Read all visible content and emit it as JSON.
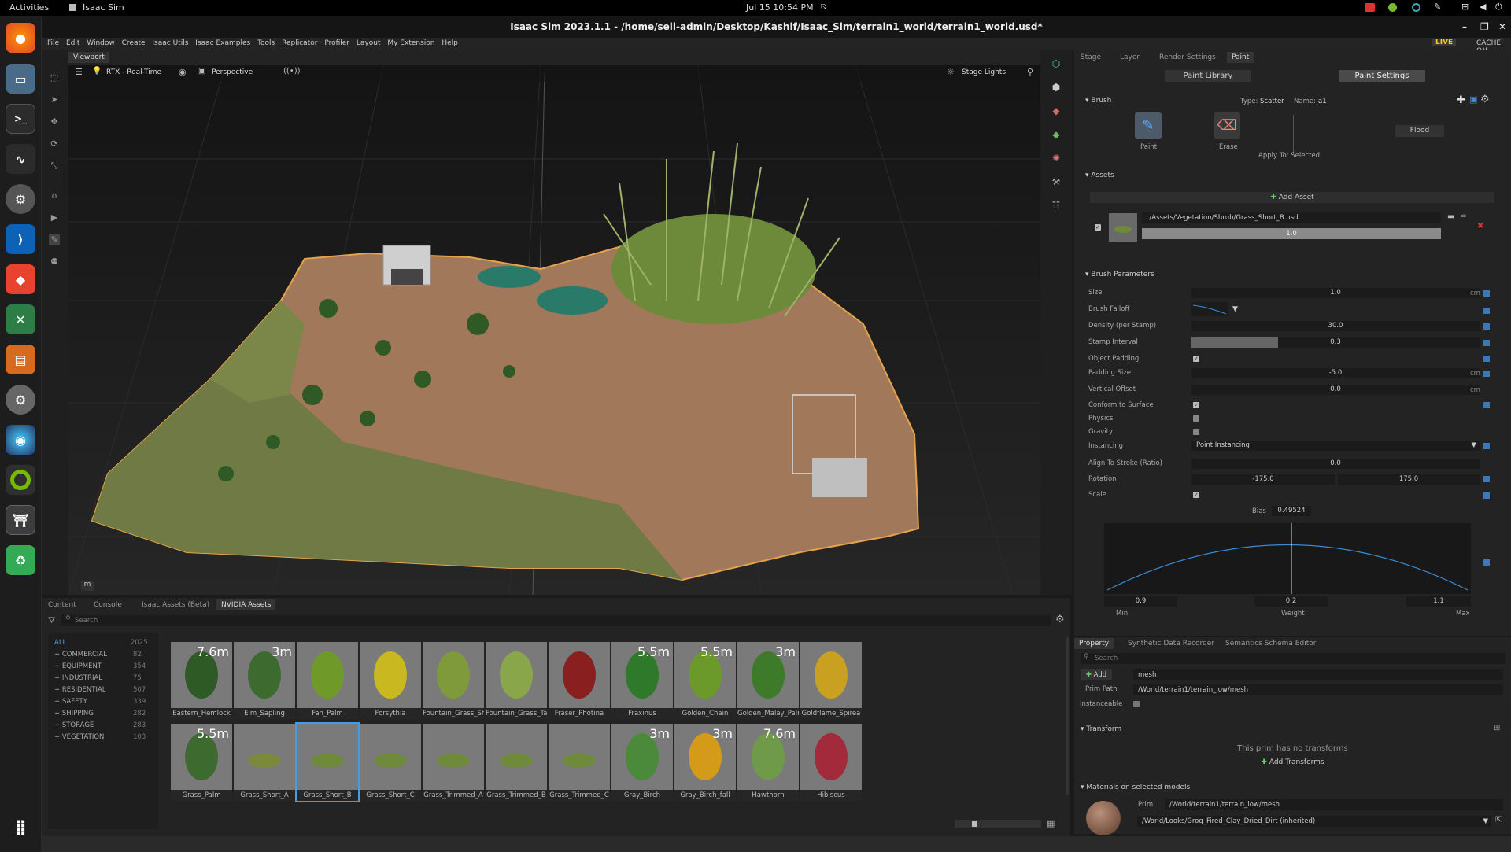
{
  "system": {
    "activities": "Activities",
    "app_name": "Isaac Sim",
    "clock": "Jul 15  10:54 PM"
  },
  "window": {
    "title": "Isaac Sim 2023.1.1 - /home/seil-admin/Desktop/Kashif/Isaac_Sim/terrain1_world/terrain1_world.usd*",
    "live": "LIVE",
    "cache": "CACHE: ON"
  },
  "menu": [
    "File",
    "Edit",
    "Window",
    "Create",
    "Isaac Utils",
    "Isaac Examples",
    "Tools",
    "Replicator",
    "Profiler",
    "Layout",
    "My Extension",
    "Help"
  ],
  "viewport": {
    "tab": "Viewport",
    "renderer": "RTX - Real-Time",
    "camera": "Perspective",
    "lights": "Stage Lights",
    "corner_label": "m"
  },
  "right_tabs": [
    "Stage",
    "Layer",
    "Render Settings",
    "Paint"
  ],
  "paint": {
    "library_btn": "Paint Library",
    "settings_btn": "Paint Settings",
    "brush_section": "Brush",
    "type_label": "Type:",
    "type_value": "Scatter",
    "name_label": "Name:",
    "name_value": "a1",
    "paint_tool": "Paint",
    "erase_tool": "Erase",
    "flood_btn": "Flood",
    "apply_to": "Apply To: Selected",
    "assets_section": "Assets",
    "add_asset": "Add Asset",
    "asset_path": "../Assets/Vegetation/Shrub/Grass_Short_B.usd",
    "asset_weight": "1.0",
    "params_section": "Brush Parameters",
    "params": [
      {
        "label": "Size",
        "value": "1.0",
        "unit": "cm"
      },
      {
        "label": "Brush Falloff",
        "value": "",
        "unit": ""
      },
      {
        "label": "Density (per Stamp)",
        "value": "30.0",
        "unit": ""
      },
      {
        "label": "Stamp Interval",
        "value": "0.3",
        "unit": ""
      },
      {
        "label": "Object Padding",
        "value": "",
        "unit": ""
      },
      {
        "label": "Padding Size",
        "value": "-5.0",
        "unit": "cm"
      },
      {
        "label": "Vertical Offset",
        "value": "0.0",
        "unit": "cm"
      },
      {
        "label": "Conform to Surface",
        "value": "",
        "unit": ""
      },
      {
        "label": "Physics",
        "value": "",
        "unit": ""
      },
      {
        "label": "Gravity",
        "value": "",
        "unit": ""
      },
      {
        "label": "Instancing",
        "value": "Point Instancing",
        "unit": ""
      },
      {
        "label": "Align To Stroke (Ratio)",
        "value": "0.0",
        "unit": ""
      },
      {
        "label": "Rotation",
        "value": "-175.0",
        "value2": "175.0",
        "unit": ""
      },
      {
        "label": "Scale",
        "value": "",
        "unit": ""
      }
    ],
    "stamp_interval_fill": 0.3,
    "bias_label": "Bias",
    "bias_value": "0.49524",
    "min_value": "0.9",
    "weight_value": "0.2",
    "max_value": "1.1",
    "min_label": "Min",
    "weight_label": "Weight",
    "max_label": "Max"
  },
  "bottom_tabs": [
    "Content",
    "Console",
    "Isaac Assets (Beta)",
    "NVIDIA Assets"
  ],
  "assets": {
    "search_placeholder": "Search",
    "categories": [
      {
        "name": "ALL",
        "count": "2025"
      },
      {
        "name": "+ COMMERCIAL",
        "count": "82"
      },
      {
        "name": "+ EQUIPMENT",
        "count": "354"
      },
      {
        "name": "+ INDUSTRIAL",
        "count": "75"
      },
      {
        "name": "+ RESIDENTIAL",
        "count": "507"
      },
      {
        "name": "+ SAFETY",
        "count": "339"
      },
      {
        "name": "+ SHIPPING",
        "count": "282"
      },
      {
        "name": "+ STORAGE",
        "count": "283"
      },
      {
        "name": "+ VEGETATION",
        "count": "103"
      }
    ],
    "items": [
      {
        "name": "Eastern_Hemlock",
        "size": "7.6m"
      },
      {
        "name": "Elm_Sapling",
        "size": "3m"
      },
      {
        "name": "Fan_Palm",
        "size": ""
      },
      {
        "name": "Forsythia",
        "size": ""
      },
      {
        "name": "Fountain_Grass_Short",
        "size": ""
      },
      {
        "name": "Fountain_Grass_Tall",
        "size": ""
      },
      {
        "name": "Fraser_Photina",
        "size": ""
      },
      {
        "name": "Fraxinus",
        "size": "5.5m"
      },
      {
        "name": "Golden_Chain",
        "size": "5.5m"
      },
      {
        "name": "Golden_Malay_Palm",
        "size": "3m"
      },
      {
        "name": "Goldflame_Spirea",
        "size": ""
      },
      {
        "name": "Grass_Palm",
        "size": "5.5m"
      },
      {
        "name": "Grass_Short_A",
        "size": ""
      },
      {
        "name": "Grass_Short_B",
        "size": ""
      },
      {
        "name": "Grass_Short_C",
        "size": ""
      },
      {
        "name": "Grass_Trimmed_A",
        "size": ""
      },
      {
        "name": "Grass_Trimmed_B",
        "size": ""
      },
      {
        "name": "Grass_Trimmed_C",
        "size": ""
      },
      {
        "name": "Gray_Birch",
        "size": "3m"
      },
      {
        "name": "Gray_Birch_fall",
        "size": "3m"
      },
      {
        "name": "Hawthorn",
        "size": "7.6m"
      },
      {
        "name": "Hibiscus",
        "size": ""
      }
    ]
  },
  "property": {
    "tabs": [
      "Property",
      "Synthetic Data Recorder",
      "Semantics Schema Editor"
    ],
    "search_placeholder": "Search",
    "add_btn": "Add",
    "name_value": "mesh",
    "prim_path_label": "Prim Path",
    "prim_path": "/World/terrain1/terrain_low/mesh",
    "instanceable_label": "Instanceable",
    "transform_section": "Transform",
    "no_transforms": "This prim has no transforms",
    "add_transforms": "Add Transforms",
    "materials_section": "Materials on selected models",
    "prim_label": "Prim",
    "prim_value": "/World/terrain1/terrain_low/mesh",
    "material_value": "/World/Looks/Grog_Fired_Clay_Dried_Dirt (inherited)"
  }
}
